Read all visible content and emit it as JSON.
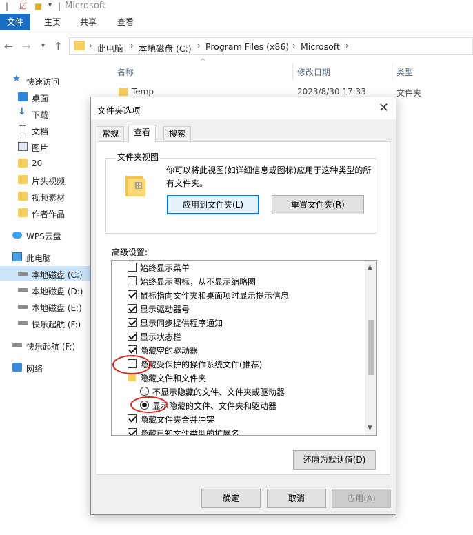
{
  "window": {
    "title": "Microsoft"
  },
  "ribbon": {
    "tabs": [
      "文件",
      "主页",
      "共享",
      "查看"
    ]
  },
  "address": {
    "crumbs": [
      "此电脑",
      "本地磁盘 (C:)",
      "Program Files (x86)",
      "Microsoft"
    ]
  },
  "columns": {
    "name": "名称",
    "date": "修改日期",
    "type": "类型"
  },
  "files": [
    {
      "name": "Temp",
      "date": "2023/8/30 17:33",
      "type": "文件夹"
    }
  ],
  "sidebar": {
    "items": [
      {
        "label": "快速访问",
        "icon": "star-icon"
      },
      {
        "label": "桌面",
        "icon": "desktop-icon"
      },
      {
        "label": "下载",
        "icon": "download-icon"
      },
      {
        "label": "文档",
        "icon": "document-icon"
      },
      {
        "label": "图片",
        "icon": "picture-icon"
      },
      {
        "label": "20",
        "icon": "folder-icon"
      },
      {
        "label": "片头视频",
        "icon": "folder-icon"
      },
      {
        "label": "视频素材",
        "icon": "folder-icon"
      },
      {
        "label": "作者作品",
        "icon": "folder-icon"
      },
      {
        "label": "WPS云盘",
        "icon": "cloud-icon"
      },
      {
        "label": "此电脑",
        "icon": "computer-icon"
      },
      {
        "label": "本地磁盘 (C:)",
        "icon": "drive-icon"
      },
      {
        "label": "本地磁盘 (D:)",
        "icon": "drive-icon"
      },
      {
        "label": "本地磁盘 (E:)",
        "icon": "drive-icon"
      },
      {
        "label": "快乐起航 (F:)",
        "icon": "drive-icon"
      },
      {
        "label": "快乐起航 (F:)",
        "icon": "drive-icon"
      },
      {
        "label": "网络",
        "icon": "network-icon"
      }
    ]
  },
  "dialog": {
    "title": "文件夹选项",
    "tabs": [
      "常规",
      "查看",
      "搜索"
    ],
    "folder_views": {
      "label": "文件夹视图",
      "description": "你可以将此视图(如详细信息或图标)应用于这种类型的所有文件夹。",
      "apply_button": "应用到文件夹(L)",
      "reset_button": "重置文件夹(R)"
    },
    "advanced": {
      "label": "高级设置:",
      "items": [
        {
          "kind": "checkbox",
          "checked": false,
          "label": "始终显示菜单"
        },
        {
          "kind": "checkbox",
          "checked": false,
          "label": "始终显示图标，从不显示缩略图"
        },
        {
          "kind": "checkbox",
          "checked": true,
          "label": "鼠标指向文件夹和桌面项时显示提示信息"
        },
        {
          "kind": "checkbox",
          "checked": true,
          "label": "显示驱动器号"
        },
        {
          "kind": "checkbox",
          "checked": true,
          "label": "显示同步提供程序通知"
        },
        {
          "kind": "checkbox",
          "checked": true,
          "label": "显示状态栏"
        },
        {
          "kind": "checkbox",
          "checked": true,
          "label": "隐藏空的驱动器"
        },
        {
          "kind": "checkbox",
          "checked": false,
          "label": "隐藏受保护的操作系统文件(推荐)"
        },
        {
          "kind": "folder",
          "label": "隐藏文件和文件夹"
        },
        {
          "kind": "radio",
          "checked": false,
          "label": "不显示隐藏的文件、文件夹或驱动器"
        },
        {
          "kind": "radio",
          "checked": true,
          "label": "显示隐藏的文件、文件夹和驱动器"
        },
        {
          "kind": "checkbox",
          "checked": true,
          "label": "隐藏文件夹合并冲突"
        },
        {
          "kind": "checkbox",
          "checked": true,
          "label": "隐藏已知文件类型的扩展名"
        }
      ]
    },
    "restore_button": "还原为默认值(D)",
    "ok_button": "确定",
    "cancel_button": "取消",
    "apply_button": "应用(A)"
  },
  "colors": {
    "accent": "#1a6fc4",
    "annotation": "#e0201a",
    "selected": "#cce4f7"
  }
}
